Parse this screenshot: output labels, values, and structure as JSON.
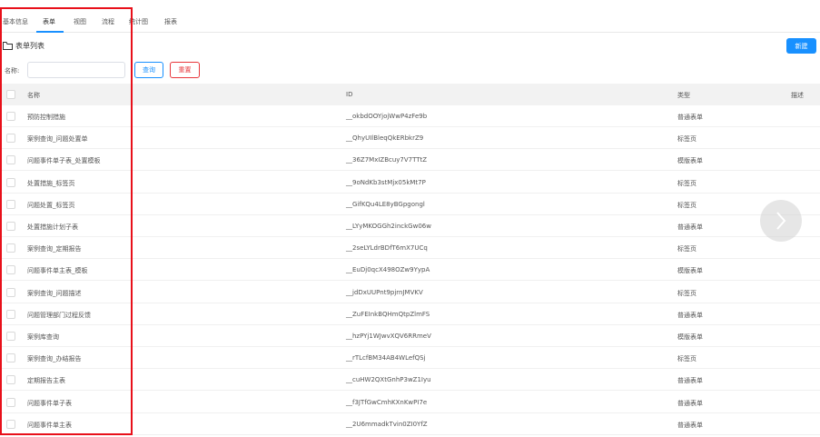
{
  "tabs": [
    {
      "label": "基本信息"
    },
    {
      "label": "表单"
    },
    {
      "label": "视图"
    },
    {
      "label": "流程"
    },
    {
      "label": "统计图"
    },
    {
      "label": "报表"
    }
  ],
  "active_tab": 1,
  "section_title": "表单列表",
  "new_button_label": "新建",
  "search": {
    "label": "名称:",
    "value": "",
    "placeholder": "",
    "query_label": "查询",
    "reset_label": "重置"
  },
  "table": {
    "columns": [
      "名称",
      "ID",
      "类型",
      "描述"
    ],
    "rows": [
      {
        "name": "预防控制措施",
        "id": "__okbdOOYjojWwP4zFe9b",
        "type": "普通表单",
        "desc": ""
      },
      {
        "name": "案例查询_问题处置单",
        "id": "__QhyUIlBleqQkERbkrZ9",
        "type": "标签页",
        "desc": ""
      },
      {
        "name": "问题事件单子表_处置模板",
        "id": "__36Z7MxIZBcuy7V7TTtZ",
        "type": "模版表单",
        "desc": ""
      },
      {
        "name": "处置措施_标签页",
        "id": "__9oNdKb3stMjx05kMt7P",
        "type": "标签页",
        "desc": ""
      },
      {
        "name": "问题处置_标签页",
        "id": "__GifKQu4LE8yBGpgongl",
        "type": "标签页",
        "desc": ""
      },
      {
        "name": "处置措施计划子表",
        "id": "__LYyMKOGGh2inckGw06w",
        "type": "普通表单",
        "desc": ""
      },
      {
        "name": "案例查询_定期报告",
        "id": "__2seLYLdrBDfT6mX7UCq",
        "type": "标签页",
        "desc": ""
      },
      {
        "name": "问题事件单主表_模板",
        "id": "__EuDj0qcX498OZw9YypA",
        "type": "模版表单",
        "desc": ""
      },
      {
        "name": "案例查询_问题描述",
        "id": "__jdDxUUPnt9pjrnJMVKV",
        "type": "标签页",
        "desc": ""
      },
      {
        "name": "问题管理部门过程反馈",
        "id": "__ZuFEInkBQHmQtpZlmFS",
        "type": "普通表单",
        "desc": ""
      },
      {
        "name": "案例库查询",
        "id": "__hzPYj1WJwvXQV6RRmeV",
        "type": "模版表单",
        "desc": ""
      },
      {
        "name": "案例查询_办结报告",
        "id": "__rTLcfBM34AB4WLefQSj",
        "type": "标签页",
        "desc": ""
      },
      {
        "name": "定期报告主表",
        "id": "__cuHW2QXtGnhP3wZ1Iyu",
        "type": "普通表单",
        "desc": ""
      },
      {
        "name": "问题事件单子表",
        "id": "__f3JTfGwCmhKXnKwPI7e",
        "type": "普通表单",
        "desc": ""
      },
      {
        "name": "问题事件单主表",
        "id": "__2U6mmadkTvin0ZI0YfZ",
        "type": "普通表单",
        "desc": ""
      }
    ]
  },
  "colors": {
    "primary": "#1890ff",
    "danger": "#e8363b",
    "highlight": "#e8101a",
    "header_bg": "#f2f2f2"
  },
  "icons": {
    "folder": "folder-icon",
    "next": "chevron-right-icon"
  }
}
